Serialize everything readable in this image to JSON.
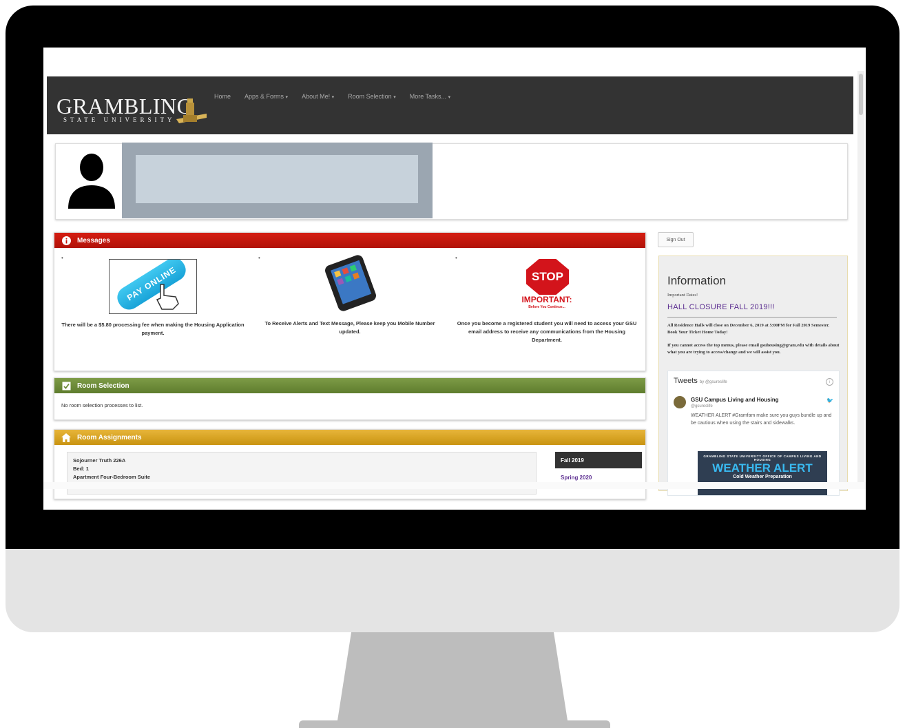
{
  "nav": {
    "logo_main": "GRAMBLING",
    "logo_sub": "STATE UNIVERSITY",
    "items": [
      {
        "label": "Home",
        "dropdown": false
      },
      {
        "label": "Apps & Forms",
        "dropdown": true
      },
      {
        "label": "About Me!",
        "dropdown": true
      },
      {
        "label": "Room Selection",
        "dropdown": true
      },
      {
        "label": "More Tasks...",
        "dropdown": true
      }
    ]
  },
  "messages": {
    "title": "Messages",
    "pay_button": "PAY ONLINE",
    "col1_text": "There will be a $5.80 processing fee when making the Housing Application payment.",
    "col2_text": "To Receive Alerts and Text Message, Please keep you Mobile Number updated.",
    "col3_text": "Once you become a registered student you will need to access your GSU email address to receive any communications from the Housing Department.",
    "stop_label": "STOP",
    "important_label": "IMPORTANT:",
    "before_label": "Before You Continue..."
  },
  "room_selection": {
    "title": "Room Selection",
    "text": "No room selection processes to list."
  },
  "room_assignments": {
    "title": "Room Assignments",
    "line1": "Sojourner Truth 226A",
    "line2": "Bed: 1",
    "line3": "Apartment Four-Bedroom Suite",
    "term_active": "Fall 2019",
    "term_link": "Spring 2020"
  },
  "sidebar": {
    "signout": "Sign Out",
    "info_title": "Information",
    "info_sub": "Important Dates!",
    "info_head": "HALL CLOSURE FALL 2019!!!",
    "p1": "All Residence Halls will close on December 6, 2019 at 5:00PM for Fall 2019 Semester. Book Your Ticket Home Today!",
    "p2": "If you cannot access the top menus, please email gsuhousing@gram.edu with details about what you are trying to access/change and we will assist you."
  },
  "tweets": {
    "title": "Tweets",
    "by": "by @gsureslife",
    "name": "GSU Campus Living and Housing",
    "handle": "@gsureslife",
    "text": "WEATHER ALERT #Gramfam make sure you guys bundle up and be cautious when using the stairs and sidewalks.",
    "img_line1": "GRAMBLING STATE UNIVERSITY OFFICE OF CAMPUS LIVING AND HOUSING",
    "img_line2": "WEATHER ALERT",
    "img_line3": "Cold Weather Preparation"
  },
  "colors": {
    "navbar": "#333333",
    "messages_header": "#c8170d",
    "room_selection_header": "#6e8c3a",
    "room_assignments_header": "#d9a424",
    "link_purple": "#5b2d90"
  },
  "icons": [
    "info-circle-icon",
    "checkbox-icon",
    "home-icon",
    "person-silhouette-icon",
    "pointer-hand-icon",
    "smartphone-icon",
    "info-icon",
    "twitter-bird-icon"
  ]
}
